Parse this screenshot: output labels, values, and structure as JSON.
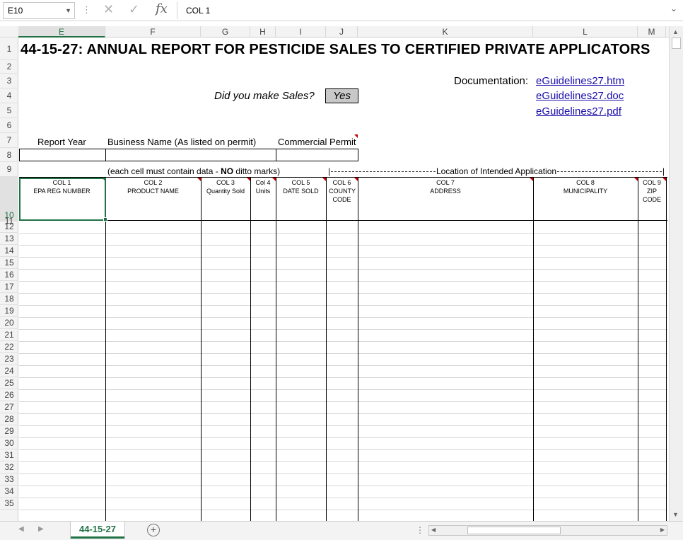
{
  "formula_bar": {
    "name_box": "E10",
    "cancel_icon": "x-icon",
    "enter_icon": "check-icon",
    "fx_label": "fx",
    "formula": "COL 1"
  },
  "columns": [
    "E",
    "F",
    "G",
    "H",
    "I",
    "J",
    "K",
    "L",
    "M"
  ],
  "selected_column": "E",
  "rows": [
    "1",
    "2",
    "3",
    "4",
    "5",
    "6",
    "7",
    "8",
    "9",
    "10",
    "11",
    "12",
    "13",
    "14",
    "15",
    "16",
    "17",
    "18",
    "19",
    "20",
    "21",
    "22",
    "23",
    "24",
    "25",
    "26",
    "27",
    "28",
    "29",
    "30",
    "31",
    "32",
    "33",
    "34",
    "35"
  ],
  "selected_row": "10",
  "sheet": {
    "title": "44-15-27: ANNUAL REPORT FOR PESTICIDE SALES TO CERTIFIED PRIVATE APPLICATORS",
    "documentation_label": "Documentation:",
    "documentation_links": [
      "eGuidelines27.htm",
      "eGuidelines27.doc",
      "eGuidelines27.pdf"
    ],
    "sales_question": "Did you make Sales?",
    "sales_answer": "Yes",
    "report_year_label": "Report Year",
    "business_name_label": "Business Name (As listed on permit)",
    "commercial_permit_label": "Commercial Permit",
    "note_prefix": "(each cell must contain data - ",
    "note_bold": "NO",
    "note_suffix": " ditto marks)",
    "location_prefix": "|",
    "location_label": "Location of Intended Application",
    "location_suffix": "|",
    "headers": [
      {
        "code": "COL 1",
        "label": "EPA REG NUMBER"
      },
      {
        "code": "COL 2",
        "label": "PRODUCT NAME"
      },
      {
        "code": "COL 3",
        "label": "Quantity Sold"
      },
      {
        "code": "Col 4",
        "label": "Units"
      },
      {
        "code": "COL 5",
        "label": "DATE SOLD"
      },
      {
        "code": "COL 6",
        "label": "COUNTY CODE"
      },
      {
        "code": "COL 7",
        "label": "ADDRESS"
      },
      {
        "code": "COL 8",
        "label": "MUNICIPALITY"
      },
      {
        "code": "COL 9",
        "label": "ZIP CODE"
      }
    ]
  },
  "tabs": {
    "active": "44-15-27",
    "add_icon": "plus-circle-icon"
  },
  "colors": {
    "accent": "#217346",
    "link": "#1a0dab",
    "comment_marker": "#c00000"
  }
}
